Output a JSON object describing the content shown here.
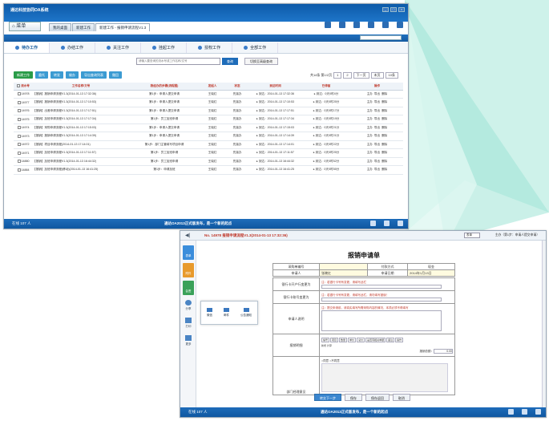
{
  "colors": {
    "accent": "#1e6cba",
    "teal": "#9fe3d5",
    "red": "#c0392b"
  },
  "win1": {
    "app_title": "通达科技协同OA系统",
    "menu_label": "菜单",
    "tabs": [
      "我的桌面",
      "新建工作",
      "新建工作 - 报销申请流程V1.3"
    ],
    "nav": [
      {
        "label": "待办工作",
        "icon": "clock-icon"
      },
      {
        "label": "办结工作",
        "icon": "check-icon"
      },
      {
        "label": "关注工作",
        "icon": "star-icon"
      },
      {
        "label": "挂起工作",
        "icon": "pause-icon"
      },
      {
        "label": "授权工作",
        "icon": "key-icon"
      },
      {
        "label": "全部工作",
        "icon": "list-icon"
      }
    ],
    "search_placeholder": "请输入要查询的流水号或工作名称/文号",
    "query_button": "查询",
    "reset_button": "切换至高级查询",
    "actions": [
      "新建工作",
      "委托",
      "转发",
      "催办",
      "导出查询列表",
      "撤回"
    ],
    "pager": {
      "info": "共14条 第1/2页",
      "page": "1",
      "pages": "2",
      "next": "下一页",
      "last": "末页",
      "size": "10条"
    },
    "columns": [
      "流水号",
      "工作名称/文号",
      "我经办的步骤(流程图)",
      "发起人",
      "状态",
      "到达时间",
      "已停留",
      "操作"
    ],
    "rows": [
      {
        "id": "14978",
        "name": "【报销】报销申请流程V1.3(2014-01-13 17:32:36)",
        "step": "第1步：申请人提交申请",
        "owner": "王晓红",
        "status": "先接办",
        "arrive": "2014-01-13 17:32:36",
        "stay": "0天0时4分",
        "ops": [
          "主办",
          "导出",
          "删除"
        ]
      },
      {
        "id": "14977",
        "name": "【报销】报销申请流程V1.3(2014-01-13 17:10:53)",
        "step": "第1步：申请人提交申请",
        "owner": "王晓红",
        "status": "先接办",
        "arrive": "2014-01-13 17:10:53",
        "stay": "0天0时25分",
        "ops": [
          "主办",
          "导出",
          "删除"
        ]
      },
      {
        "id": "14976",
        "name": "【报销】出差申请流程V1.3(2014-01-13 17:17:51)",
        "step": "第1步：申请人提交申请",
        "owner": "王晓红",
        "status": "先接办",
        "arrive": "2014-01-13 17:17:51",
        "stay": "0天0时17分",
        "ops": [
          "主办",
          "导出",
          "删除"
        ]
      },
      {
        "id": "14975",
        "name": "【报销】加班申请流程V1.3(2014-01-13 17:17:34)",
        "step": "第1步：员工加班申请",
        "owner": "王晓红",
        "status": "先接办",
        "arrive": "2014-01-13 17:17:34",
        "stay": "0天0时19分",
        "ops": [
          "主办",
          "导出",
          "删除"
        ]
      },
      {
        "id": "14974",
        "name": "【报销】采购申请流程V1.3(2014-01-13 17:15:03)",
        "step": "第1步：申请人提交申请",
        "owner": "王晓红",
        "status": "先接办",
        "arrive": "2014-01-13 17:15:03",
        "stay": "0天0时21分",
        "ops": [
          "主办",
          "导出",
          "删除"
        ]
      },
      {
        "id": "14973",
        "name": "【报销】报销申请流程V1.3(2014-01-13 17:14:39)",
        "step": "第1步：申请人提交申请",
        "owner": "王晓红",
        "status": "先接办",
        "arrive": "2014-01-13 17:14:39",
        "stay": "0天0时21分",
        "ops": [
          "主办",
          "导出",
          "删除"
        ]
      },
      {
        "id": "14972",
        "name": "【报销】项目申请流程(2014-01-13 17:14:01)",
        "step": "第1步：部门主管填写项目申请",
        "owner": "王晓红",
        "status": "先接办",
        "arrive": "2014-01-13 17:14:01",
        "stay": "0天0时22分",
        "ops": [
          "主办",
          "导出",
          "删除"
        ]
      },
      {
        "id": "14971",
        "name": "【报销】加班申请流程V1.3(2014-01-13 17:11:57)",
        "step": "第1步：员工加班申请",
        "owner": "王晓红",
        "status": "先接办",
        "arrive": "2014-01-13 17:11:57",
        "stay": "0天0时25分",
        "ops": [
          "主办",
          "导出",
          "删除"
        ]
      },
      {
        "id": "14880",
        "name": "【报销】加班申请流程V1.3(2014-01-13 16:44:32)",
        "step": "第1步：员工加班申请",
        "owner": "王晓红",
        "status": "先接办",
        "arrive": "2014-01-13 16:44:32",
        "stay": "0天0时52分",
        "ops": [
          "主办",
          "导出",
          "删除"
        ]
      },
      {
        "id": "14884",
        "name": "【报销】加班申请流程(移动)(2014-01-13 16:41:25)",
        "step": "第1步：申请加班",
        "owner": "王晓红",
        "status": "先接办",
        "arrive": "2014-01-13 16:41:25",
        "stay": "0天0时55分",
        "ops": [
          "主办",
          "导出",
          "删除"
        ]
      }
    ],
    "status_left": "在线  107  人",
    "status_mid": "通达OA2013正式版发布，是一个新的起点"
  },
  "win2": {
    "doc_title": "No. 14978 报销申请流程V1.3(2014-01-13 17:32:36)",
    "view_select": "表单",
    "step_info": "主办（第1步：申请人提交申请）",
    "side": [
      "表单",
      "附件",
      "会签",
      "分享",
      "打印",
      "更多"
    ],
    "popup": [
      "微信",
      "邮件",
      "公告通知"
    ],
    "form_title": "报销申请单",
    "f_purchase_no": "采购单编号",
    "f_pay_method": "付款方式",
    "f_pay_value": "现金",
    "f_applicant": "申请人",
    "f_applicant_value": "张晓红",
    "f_date": "申请日期",
    "f_date_value": "2014年1月13日",
    "f_bank_change": "银行卡开户行变更为",
    "f_bank_hint": "注：若银行卡号有变更，请填写此栏",
    "f_card_change": "银行卡账号变更为",
    "f_card_hint": "注：若银行卡号有变更，请填写此栏，请勿填写错误！",
    "f_desc": "申请人说明",
    "f_desc_hint": "注：提交申请前，请真实填写所需采购内容的情况，本项必须不得填写",
    "f_detail": "报销明细",
    "f_detail_cols": [
      "编号",
      "项目",
      "数量",
      "单价",
      "总价",
      "是否有相关单据",
      "备注",
      "操作"
    ],
    "f_detail_add": "新增  计算",
    "f_total": "报销总额：",
    "f_total_value": "0.00",
    "f_dept": "部门经理意见",
    "f_agree": "○同意  ○不同意",
    "buttons": [
      "转交下一步",
      "保存",
      "保存返回",
      "取消"
    ],
    "status_left": "在线  107  人",
    "status_mid": "通达OA2013正式版发布，是一个新的起点"
  }
}
